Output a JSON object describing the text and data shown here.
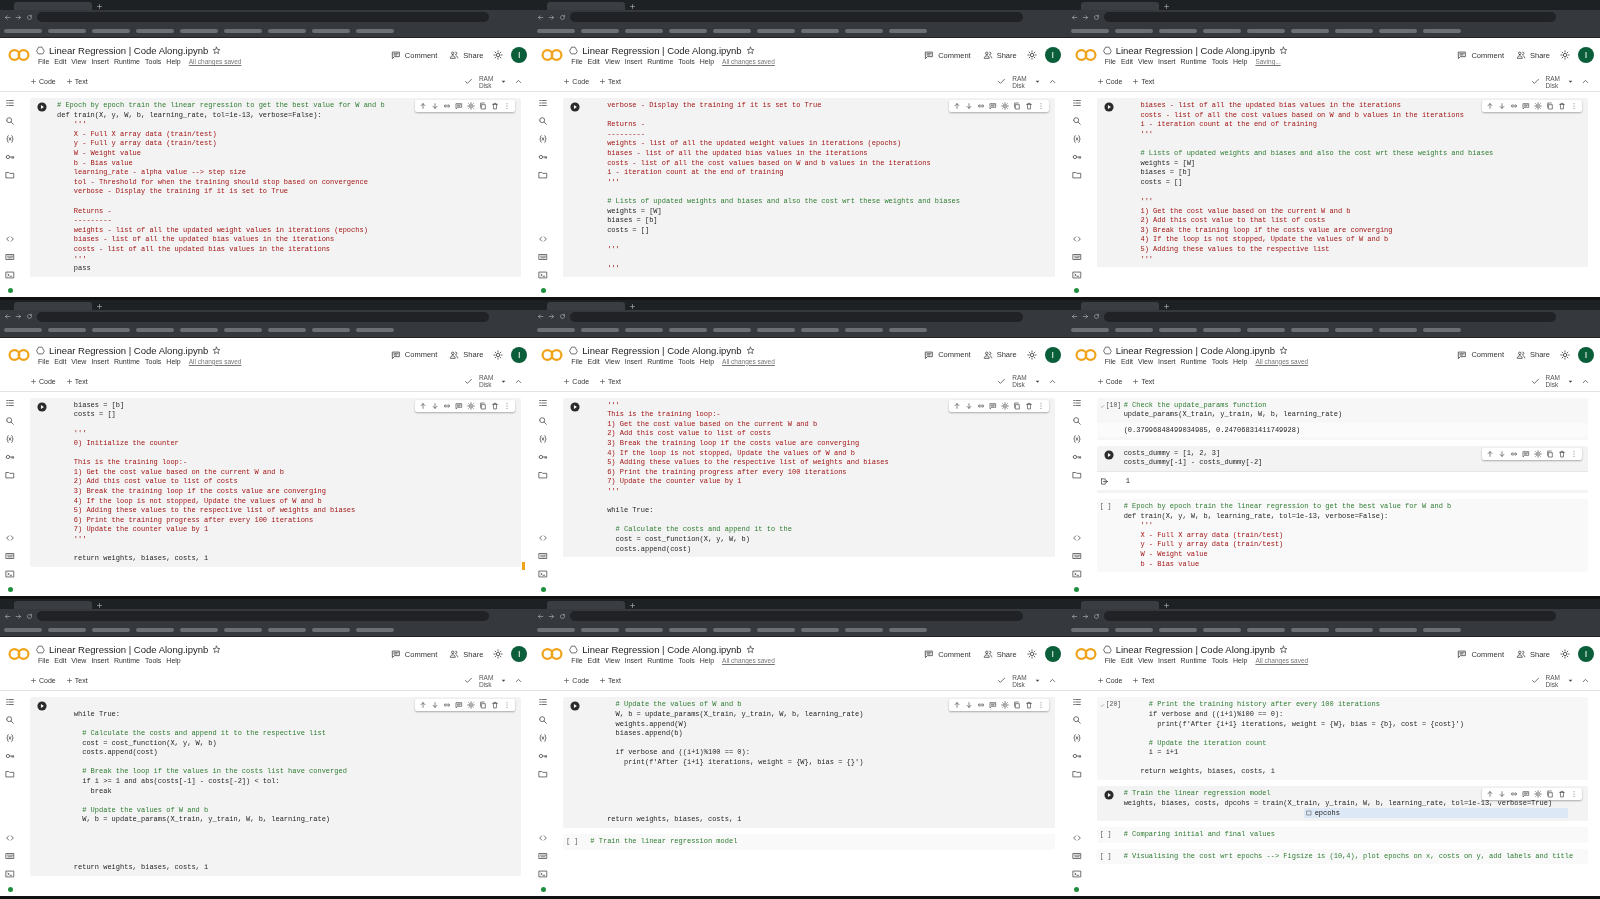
{
  "panels": [
    {
      "title": "Linear Regression | Code Along.ipynb",
      "menu": [
        "File",
        "Edit",
        "View",
        "Insert",
        "Runtime",
        "Tools",
        "Help"
      ],
      "save_status": "All changes saved",
      "comment": "Comment",
      "share": "Share",
      "avatar": "I",
      "add": [
        "Code",
        "Text"
      ],
      "resources": [
        "RAM",
        "Disk"
      ],
      "cells": [
        {
          "kind": "run",
          "toolbar": true,
          "lines": [
            {
              "kind": "comment",
              "text": "# Epoch by epoch train the linear regression to get the best value for W and b"
            },
            {
              "kind": "code",
              "text": "def train(X, y, W, b, learning_rate, tol=1e-13, verbose=False):"
            },
            {
              "kind": "doc",
              "text": "    '''"
            },
            {
              "kind": "doc",
              "text": "    X - Full X array data (train/test)"
            },
            {
              "kind": "doc",
              "text": "    y - Full y array data (train/test)"
            },
            {
              "kind": "doc",
              "text": "    W - Weight value"
            },
            {
              "kind": "doc",
              "text": "    b - Bias value"
            },
            {
              "kind": "doc",
              "text": "    learning_rate - alpha value --> step size"
            },
            {
              "kind": "doc",
              "text": "    tol - Threshold for when the training should stop based on convergence"
            },
            {
              "kind": "doc",
              "text": "    verbose - Display the training if it is set to True"
            },
            {
              "kind": "blank"
            },
            {
              "kind": "doc",
              "text": "    Returns -"
            },
            {
              "kind": "doc",
              "text": "    ---------"
            },
            {
              "kind": "doc",
              "text": "    weights - list of all the updated weight values in iterations (epochs)"
            },
            {
              "kind": "doc",
              "text": "    biases - list of all the updated bias values in the iterations"
            },
            {
              "kind": "doc",
              "text": "    costs - list of all the updated bias values in the iterations"
            },
            {
              "kind": "doc",
              "text": "    '''"
            },
            {
              "kind": "code",
              "text": "    pass"
            }
          ]
        }
      ]
    },
    {
      "title": "Linear Regression | Code Along.ipynb",
      "menu": [
        "File",
        "Edit",
        "View",
        "Insert",
        "Runtime",
        "Tools",
        "Help"
      ],
      "save_status": "All changes saved",
      "comment": "Comment",
      "share": "Share",
      "avatar": "I",
      "add": [
        "Code",
        "Text"
      ],
      "resources": [
        "RAM",
        "Disk"
      ],
      "cells": [
        {
          "kind": "run",
          "toolbar": true,
          "lines": [
            {
              "kind": "doc",
              "text": "    verbose - Display the training if it is set to True"
            },
            {
              "kind": "blank"
            },
            {
              "kind": "doc",
              "text": "    Returns -"
            },
            {
              "kind": "doc",
              "text": "    ---------"
            },
            {
              "kind": "doc",
              "text": "    weights - list of all the updated weight values in iterations (epochs)"
            },
            {
              "kind": "doc",
              "text": "    biases - list of all the updated bias values in the iterations"
            },
            {
              "kind": "doc",
              "text": "    costs - list of all the cost values based on W and b values in the iterations"
            },
            {
              "kind": "doc",
              "text": "    i - iteration count at the end of training"
            },
            {
              "kind": "doc",
              "text": "    '''"
            },
            {
              "kind": "blank"
            },
            {
              "kind": "comment",
              "text": "    # Lists of updated weights and biases and also the cost wrt these weights and biases"
            },
            {
              "kind": "code",
              "text": "    weights = [W]"
            },
            {
              "kind": "code",
              "text": "    biases = [b]"
            },
            {
              "kind": "code",
              "text": "    costs = []"
            },
            {
              "kind": "blank"
            },
            {
              "kind": "doc",
              "text": "    '''"
            },
            {
              "kind": "blank"
            },
            {
              "kind": "doc",
              "text": "    '''"
            }
          ]
        }
      ]
    },
    {
      "title": "Linear Regression | Code Along.ipynb",
      "menu": [
        "File",
        "Edit",
        "View",
        "Insert",
        "Runtime",
        "Tools",
        "Help"
      ],
      "save_status": "Saving...",
      "comment": "Comment",
      "share": "Share",
      "avatar": "I",
      "add": [
        "Code",
        "Text"
      ],
      "resources": [
        "RAM",
        "Disk"
      ],
      "cells": [
        {
          "kind": "run",
          "toolbar": true,
          "lines": [
            {
              "kind": "doc",
              "text": "    biases - list of all the updated bias values in the iterations"
            },
            {
              "kind": "doc",
              "text": "    costs - list of all the cost values based on W and b values in the iterations"
            },
            {
              "kind": "doc",
              "text": "    i - iteration count at the end of training"
            },
            {
              "kind": "doc",
              "text": "    '''"
            },
            {
              "kind": "blank"
            },
            {
              "kind": "comment",
              "text": "    # Lists of updated weights and biases and also the cost wrt these weights and biases"
            },
            {
              "kind": "code",
              "text": "    weights = [W]"
            },
            {
              "kind": "code",
              "text": "    biases = [b]"
            },
            {
              "kind": "code",
              "text": "    costs = []"
            },
            {
              "kind": "blank"
            },
            {
              "kind": "doc",
              "text": "    '''"
            },
            {
              "kind": "doc",
              "text": "    1) Get the cost value based on the current W and b"
            },
            {
              "kind": "doc",
              "text": "    2) Add this cost value to that list of costs"
            },
            {
              "kind": "doc",
              "text": "    3) Break the training loop if the costs value are converging"
            },
            {
              "kind": "doc",
              "text": "    4) If the loop is not stopped, Update the values of W and b"
            },
            {
              "kind": "doc",
              "text": "    5) Adding these values to the respective list"
            },
            {
              "kind": "doc",
              "text": "    '''"
            }
          ]
        }
      ]
    },
    {
      "title": "Linear Regression | Code Along.ipynb",
      "menu": [
        "File",
        "Edit",
        "View",
        "Insert",
        "Runtime",
        "Tools",
        "Help"
      ],
      "save_status": "All changes saved",
      "comment": "Comment",
      "share": "Share",
      "avatar": "I",
      "add": [
        "Code",
        "Text"
      ],
      "resources": [
        "RAM",
        "Disk"
      ],
      "scroll_marker": true,
      "cells": [
        {
          "kind": "run",
          "toolbar": true,
          "lines": [
            {
              "kind": "code",
              "text": "    biases = [b]"
            },
            {
              "kind": "code",
              "text": "    costs = []"
            },
            {
              "kind": "blank"
            },
            {
              "kind": "doc",
              "text": "    '''"
            },
            {
              "kind": "doc",
              "text": "    0) Initialize the counter"
            },
            {
              "kind": "blank"
            },
            {
              "kind": "doc",
              "text": "    This is the training loop:-"
            },
            {
              "kind": "doc",
              "text": "    1) Get the cost value based on the current W and b"
            },
            {
              "kind": "doc",
              "text": "    2) Add this cost value to list of costs"
            },
            {
              "kind": "doc",
              "text": "    3) Break the training loop if the costs value are converging"
            },
            {
              "kind": "doc",
              "text": "    4) If the loop is not stopped, Update the values of W and b"
            },
            {
              "kind": "doc",
              "text": "    5) Adding these values to the respective list of weights and biases"
            },
            {
              "kind": "doc",
              "text": "    6) Print the training progress after every 100 iterations"
            },
            {
              "kind": "doc",
              "text": "    7) Update the counter value by 1"
            },
            {
              "kind": "doc",
              "text": "    '''"
            },
            {
              "kind": "blank"
            },
            {
              "kind": "code",
              "text": "    return weights, biases, costs, i"
            }
          ]
        }
      ]
    },
    {
      "title": "Linear Regression | Code Along.ipynb",
      "menu": [
        "File",
        "Edit",
        "View",
        "Insert",
        "Runtime",
        "Tools",
        "Help"
      ],
      "save_status": "All changes saved",
      "comment": "Comment",
      "share": "Share",
      "avatar": "I",
      "add": [
        "Code",
        "Text"
      ],
      "resources": [
        "RAM",
        "Disk"
      ],
      "cells": [
        {
          "kind": "run",
          "toolbar": true,
          "lines": [
            {
              "kind": "doc",
              "text": "    '''"
            },
            {
              "kind": "doc",
              "text": "    This is the training loop:-"
            },
            {
              "kind": "doc",
              "text": "    1) Get the cost value based on the current W and b"
            },
            {
              "kind": "doc",
              "text": "    2) Add this cost value to list of costs"
            },
            {
              "kind": "doc",
              "text": "    3) Break the training loop if the costs value are converging"
            },
            {
              "kind": "doc",
              "text": "    4) If the loop is not stopped, Update the values of W and b"
            },
            {
              "kind": "doc",
              "text": "    5) Adding these values to the respective list of weights and biases"
            },
            {
              "kind": "doc",
              "text": "    6) Print the training progress after every 100 iterations"
            },
            {
              "kind": "doc",
              "text": "    7) Update the counter value by 1"
            },
            {
              "kind": "doc",
              "text": "    '''"
            },
            {
              "kind": "blank"
            },
            {
              "kind": "code",
              "text": "    while True:"
            },
            {
              "kind": "blank"
            },
            {
              "kind": "comment",
              "text": "      # Calculate the costs and append it to the"
            },
            {
              "kind": "code",
              "text": "      cost = cost_function(X, y, W, b)"
            },
            {
              "kind": "code",
              "text": "      costs.append(cost)"
            }
          ]
        }
      ]
    },
    {
      "title": "Linear Regression | Code Along.ipynb",
      "menu": [
        "File",
        "Edit",
        "View",
        "Insert",
        "Runtime",
        "Tools",
        "Help"
      ],
      "save_status": "All changes saved",
      "comment": "Comment",
      "share": "Share",
      "avatar": "I",
      "add": [
        "Code",
        "Text"
      ],
      "resources": [
        "RAM",
        "Disk"
      ],
      "cells": [
        {
          "kind": "executed",
          "prompt": "[10]",
          "lines": [
            {
              "kind": "comment",
              "text": "# Check the update_params function"
            },
            {
              "kind": "code",
              "text": "update_params(X_train, y_train, W, b, learning_rate)"
            }
          ],
          "output": {
            "text": "(0.37996848499034985, 0.24706831411749928)",
            "icon": false
          }
        },
        {
          "kind": "run",
          "toolbar": true,
          "lines": [
            {
              "kind": "code",
              "text": "costs_dummy = [1, 2, 3]"
            },
            {
              "kind": "code",
              "text": "costs_dummy[-1] - costs_dummy[-2]"
            }
          ],
          "output": {
            "text": "1",
            "icon": true
          }
        },
        {
          "kind": "empty",
          "prompt": "[ ]",
          "lines": [
            {
              "kind": "comment",
              "text": "# Epoch by epoch train the linear regression to get the best value for W and b"
            },
            {
              "kind": "code",
              "text": "def train(X, y, W, b, learning_rate, tol=1e-13, verbose=False):"
            },
            {
              "kind": "doc",
              "text": "    '''"
            },
            {
              "kind": "doc",
              "text": "    X - Full X array data (train/test)"
            },
            {
              "kind": "doc",
              "text": "    y - Full y array data (train/test)"
            },
            {
              "kind": "doc",
              "text": "    W - Weight value"
            },
            {
              "kind": "doc",
              "text": "    b - Bias value"
            }
          ]
        }
      ]
    },
    {
      "title": "Linear Regression | Code Along.ipynb",
      "menu": [
        "File",
        "Edit",
        "View",
        "Insert",
        "Runtime",
        "Tools",
        "Help"
      ],
      "comment": "Comment",
      "share": "Share",
      "avatar": "I",
      "add": [
        "Code",
        "Text"
      ],
      "resources": [
        "RAM",
        "Disk"
      ],
      "cells": [
        {
          "kind": "run",
          "toolbar": true,
          "lines": [
            {
              "kind": "blank"
            },
            {
              "kind": "code",
              "text": "    while True:"
            },
            {
              "kind": "blank"
            },
            {
              "kind": "comment",
              "text": "      # Calculate the costs and append it to the respective list"
            },
            {
              "kind": "code",
              "text": "      cost = cost_function(X, y, W, b)"
            },
            {
              "kind": "code",
              "text": "      costs.append(cost)"
            },
            {
              "kind": "blank"
            },
            {
              "kind": "comment",
              "text": "      # Break the loop if the values in the costs list have converged"
            },
            {
              "kind": "code",
              "text": "      if i >= 1 and abs(costs[-1] - costs[-2]) < tol:"
            },
            {
              "kind": "code",
              "text": "        break"
            },
            {
              "kind": "blank"
            },
            {
              "kind": "comment",
              "text": "      # Update the values of W and b"
            },
            {
              "kind": "code",
              "text": "      W, b = update_params(X_train, y_train, W, b, learning_rate)"
            },
            {
              "kind": "blank"
            },
            {
              "kind": "blank"
            },
            {
              "kind": "blank"
            },
            {
              "kind": "blank"
            },
            {
              "kind": "code",
              "text": "    return weights, biases, costs, i"
            }
          ]
        }
      ]
    },
    {
      "title": "Linear Regression | Code Along.ipynb",
      "menu": [
        "File",
        "Edit",
        "View",
        "Insert",
        "Runtime",
        "Tools",
        "Help"
      ],
      "save_status": "All changes saved",
      "comment": "Comment",
      "share": "Share",
      "avatar": "I",
      "add": [
        "Code",
        "Text"
      ],
      "resources": [
        "RAM",
        "Disk"
      ],
      "cells": [
        {
          "kind": "run",
          "toolbar": true,
          "lines": [
            {
              "kind": "comment",
              "text": "      # Update the values of W and b"
            },
            {
              "kind": "code",
              "text": "      W, b = update_params(X_train, y_train, W, b, learning_rate)"
            },
            {
              "kind": "code",
              "text": "      weights.append(W)"
            },
            {
              "kind": "code",
              "text": "      biases.append(b)"
            },
            {
              "kind": "blank"
            },
            {
              "kind": "code",
              "text": "      if verbose and ((i+1)%100 == 0):"
            },
            {
              "kind": "code",
              "text": "        print(f'After {i+1} iterations, weight = {W}, bias = {}')"
            },
            {
              "kind": "blank"
            },
            {
              "kind": "blank"
            },
            {
              "kind": "blank"
            },
            {
              "kind": "blank"
            },
            {
              "kind": "blank"
            },
            {
              "kind": "code",
              "text": "    return weights, biases, costs, i"
            }
          ]
        },
        {
          "kind": "empty",
          "prompt": "[ ]",
          "lines": [
            {
              "kind": "comment",
              "text": "# Train the linear regression model"
            }
          ]
        }
      ]
    },
    {
      "title": "Linear Regression | Code Along.ipynb",
      "menu": [
        "File",
        "Edit",
        "View",
        "Insert",
        "Runtime",
        "Tools",
        "Help"
      ],
      "save_status": "All changes saved",
      "comment": "Comment",
      "share": "Share",
      "avatar": "I",
      "add": [
        "Code",
        "Text"
      ],
      "resources": [
        "RAM",
        "Disk"
      ],
      "cells": [
        {
          "kind": "executed",
          "prompt": "[20]",
          "lines": [
            {
              "kind": "comment",
              "text": "      # Print the training history after every 100 iterations"
            },
            {
              "kind": "code",
              "text": "      if verbose and ((i+1)%100 == 0):"
            },
            {
              "kind": "code",
              "text": "        print(f'After {i+1} iterations, weight = {W}, bias = {b}, cost = {cost}')"
            },
            {
              "kind": "blank"
            },
            {
              "kind": "comment",
              "text": "      # Update the iteration count"
            },
            {
              "kind": "code",
              "text": "      i = i+1"
            },
            {
              "kind": "blank"
            },
            {
              "kind": "code",
              "text": "    return weights, biases, costs, i"
            }
          ]
        },
        {
          "kind": "run",
          "toolbar": true,
          "suggestion": "epcohs",
          "lines": [
            {
              "kind": "comment",
              "text": "# Train the linear regression model"
            },
            {
              "kind": "code",
              "text": "weights, biases, costs, dpcohs = train(X_train, y_train, W, b, learning_rate, tol=1e-13, verbose=True)"
            }
          ]
        },
        {
          "kind": "empty",
          "prompt": "[ ]",
          "lines": [
            {
              "kind": "comment",
              "text": "# Comparing initial and final values"
            }
          ]
        },
        {
          "kind": "empty",
          "prompt": "[ ]",
          "lines": [
            {
              "kind": "comment",
              "text": "# Visualising the cost wrt epochs --> Figsize is (10,4), plot epochs on x, costs on y, add labels and title"
            }
          ]
        }
      ]
    }
  ]
}
